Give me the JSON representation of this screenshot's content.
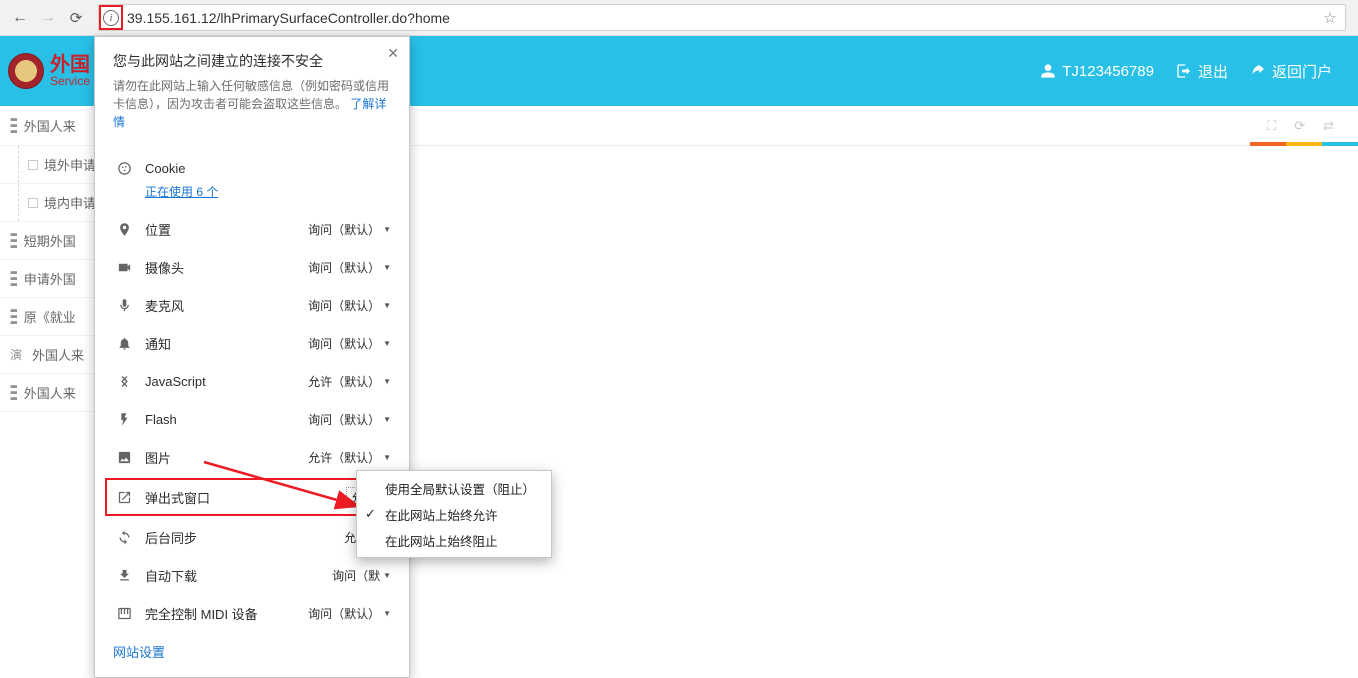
{
  "url": "39.155.161.12/lhPrimarySurfaceController.do?home",
  "logo": {
    "cn": "外国",
    "en": "Service"
  },
  "header": {
    "username": "TJ123456789",
    "logout": "退出",
    "portal": "返回门户"
  },
  "sidebar": [
    {
      "label": "外国人来",
      "kind": "top"
    },
    {
      "label": "境外申请",
      "kind": "child"
    },
    {
      "label": "境内申请",
      "kind": "child"
    },
    {
      "label": "短期外国",
      "kind": "top"
    },
    {
      "label": "申请外国",
      "kind": "top"
    },
    {
      "label": "原《就业",
      "kind": "top"
    },
    {
      "label": "外国人来",
      "kind": "special"
    },
    {
      "label": "外国人来",
      "kind": "top"
    }
  ],
  "popup": {
    "title": "您与此网站之间建立的连接不安全",
    "desc": "请勿在此网站上输入任何敏感信息（例如密码或信用卡信息），因为攻击者可能会盗取这些信息。",
    "learn_more": "了解详情",
    "cookie_label": "Cookie",
    "cookie_link": "正在使用 6 个",
    "rows": [
      {
        "icon": "pin",
        "label": "位置",
        "value": "询问（默认）"
      },
      {
        "icon": "camera",
        "label": "摄像头",
        "value": "询问（默认）"
      },
      {
        "icon": "mic",
        "label": "麦克风",
        "value": "询问（默认）"
      },
      {
        "icon": "bell",
        "label": "通知",
        "value": "询问（默认）"
      },
      {
        "icon": "js",
        "label": "JavaScript",
        "value": "允许（默认）"
      },
      {
        "icon": "flash",
        "label": "Flash",
        "value": "询问（默认）"
      },
      {
        "icon": "image",
        "label": "图片",
        "value": "允许（默认）"
      },
      {
        "icon": "popup",
        "label": "弹出式窗口",
        "value": "允许",
        "highlight": true
      },
      {
        "icon": "sync",
        "label": "后台同步",
        "value": "允许（"
      },
      {
        "icon": "download",
        "label": "自动下载",
        "value": "询问（默"
      },
      {
        "icon": "midi",
        "label": "完全控制 MIDI 设备",
        "value": "询问（默认）"
      }
    ],
    "site_settings": "网站设置"
  },
  "dropdown": {
    "items": [
      {
        "label": "使用全局默认设置（阻止）",
        "selected": false
      },
      {
        "label": "在此网站上始终允许",
        "selected": true
      },
      {
        "label": "在此网站上始终阻止",
        "selected": false
      }
    ]
  },
  "colors": {
    "strip": [
      "#f26522",
      "#fdb813",
      "#29c0e7"
    ]
  }
}
